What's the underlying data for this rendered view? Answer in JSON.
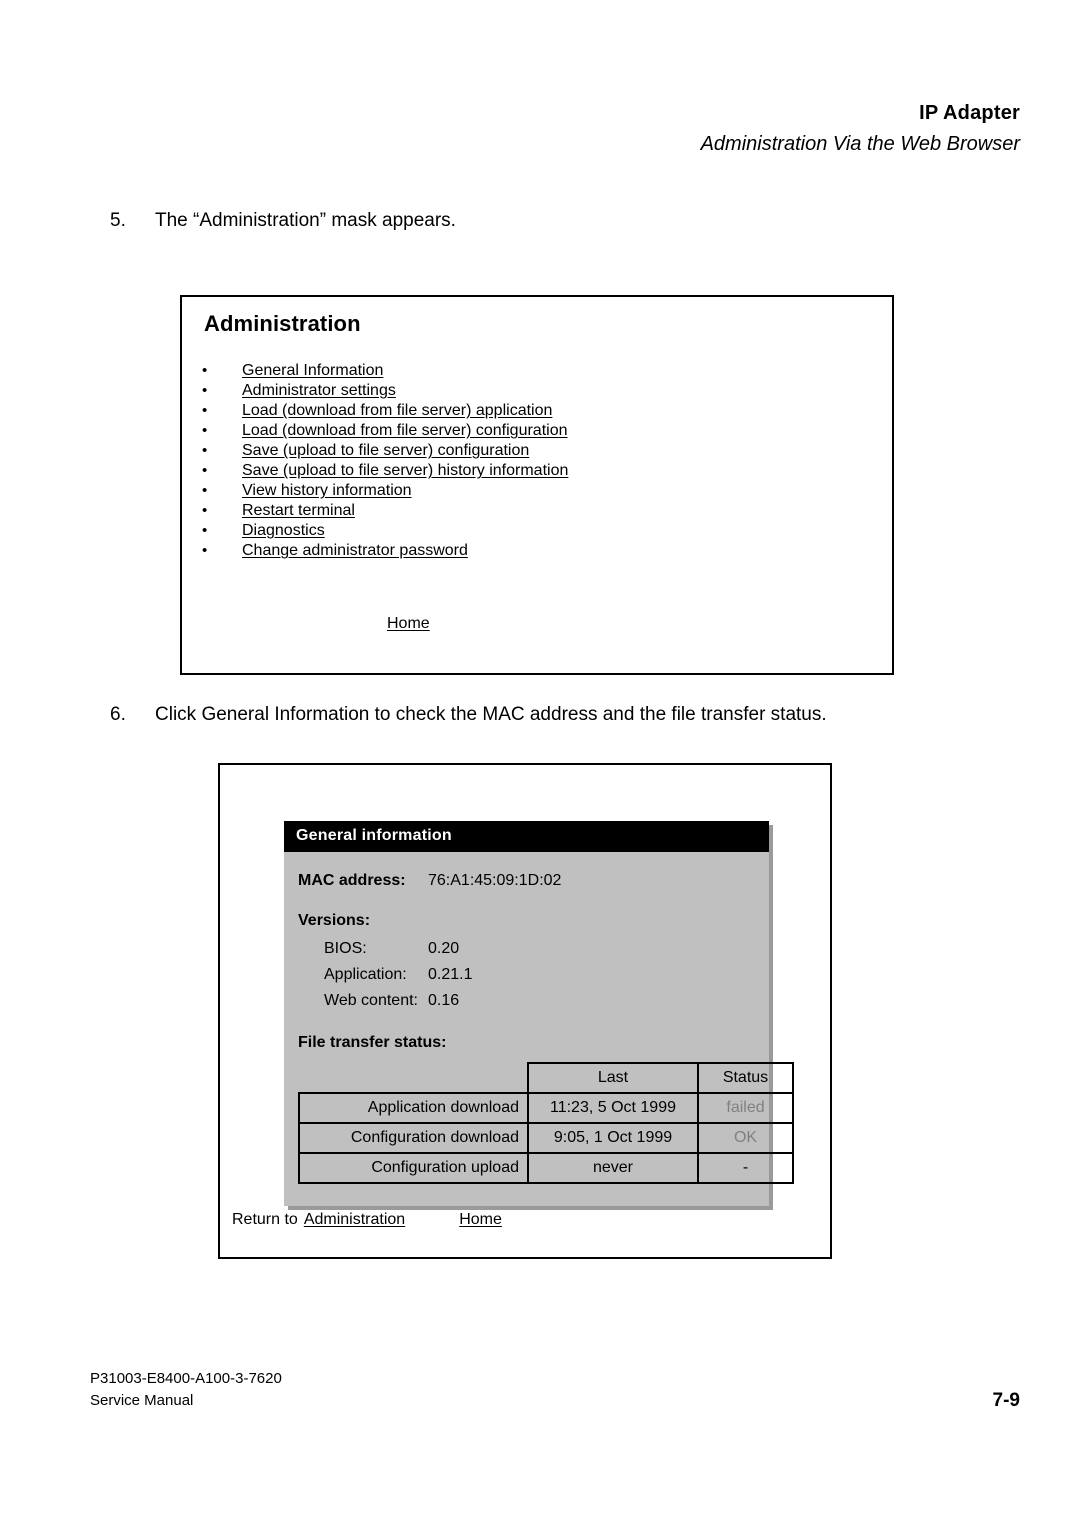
{
  "header": {
    "title": "IP Adapter",
    "subtitle": "Administration Via the Web Browser"
  },
  "steps": [
    {
      "number": "5.",
      "text": "The “Administration” mask appears."
    },
    {
      "number": "6.",
      "text": "Click General Information to check the MAC address and the file transfer status."
    }
  ],
  "administration_mask": {
    "title": "Administration",
    "bullet": "•",
    "links": [
      "General Information",
      "Administrator settings",
      "Load (download from file server) application",
      "Load (download from file server) configuration",
      "Save (upload to file server) configuration",
      "Save (upload to file server) history information",
      "View history information",
      "Restart terminal",
      "Diagnostics",
      "Change administrator password"
    ],
    "home_link": "Home"
  },
  "general_information_mask": {
    "title": "General information",
    "mac_label": "MAC address:",
    "mac_value": "76:A1:45:09:1D:02",
    "versions_label": "Versions:",
    "versions": [
      {
        "label": "BIOS:",
        "value": "0.20"
      },
      {
        "label": "Application:",
        "value": "0.21.1"
      },
      {
        "label": "Web content:",
        "value": "0.16"
      }
    ],
    "file_transfer_label": "File transfer status:",
    "table": {
      "headers": [
        "",
        "Last",
        "Status"
      ],
      "rows": [
        {
          "label": "Application download",
          "last": "11:23, 5 Oct 1999",
          "status": "failed"
        },
        {
          "label": "Configuration download",
          "last": "9:05, 1 Oct 1999",
          "status": "OK"
        },
        {
          "label": "Configuration upload",
          "last": "never",
          "status": "-"
        }
      ]
    },
    "footer": {
      "return_text": "Return to",
      "administration_link": "Administration",
      "home_link": "Home"
    }
  },
  "footer": {
    "doc_number": "P31003-E8400-A100-3-7620",
    "doc_type": "Service Manual",
    "page_number": "7-9"
  },
  "colors": {
    "panel_background": "#c0c0c0",
    "panel_shadow": "#9a9a9a",
    "titlebar_background": "#000000",
    "titlebar_text": "#ffffff",
    "status_text": "#808080"
  }
}
